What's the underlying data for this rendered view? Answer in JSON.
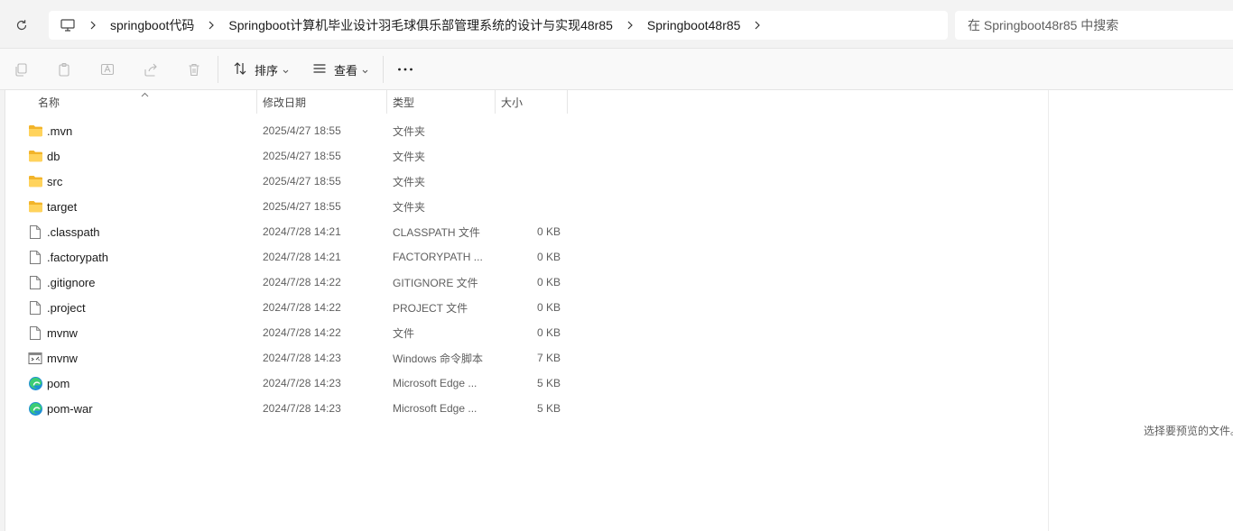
{
  "address_bar": {
    "breadcrumbs": [
      "springboot代码",
      "Springboot计算机毕业设计羽毛球俱乐部管理系统的设计与实现48r85",
      "Springboot48r85"
    ],
    "search_placeholder": "在 Springboot48r85 中搜索"
  },
  "toolbar": {
    "sort_label": "排序",
    "view_label": "查看"
  },
  "columns": {
    "name": "名称",
    "date": "修改日期",
    "type": "类型",
    "size": "大小"
  },
  "files": [
    {
      "name": ".mvn",
      "date": "2025/4/27 18:55",
      "type": "文件夹",
      "size": "",
      "icon": "folder-icon"
    },
    {
      "name": "db",
      "date": "2025/4/27 18:55",
      "type": "文件夹",
      "size": "",
      "icon": "folder-icon"
    },
    {
      "name": "src",
      "date": "2025/4/27 18:55",
      "type": "文件夹",
      "size": "",
      "icon": "folder-icon"
    },
    {
      "name": "target",
      "date": "2025/4/27 18:55",
      "type": "文件夹",
      "size": "",
      "icon": "folder-icon"
    },
    {
      "name": ".classpath",
      "date": "2024/7/28 14:21",
      "type": "CLASSPATH 文件",
      "size": "0 KB",
      "icon": "file-icon"
    },
    {
      "name": ".factorypath",
      "date": "2024/7/28 14:21",
      "type": "FACTORYPATH ...",
      "size": "0 KB",
      "icon": "file-icon"
    },
    {
      "name": ".gitignore",
      "date": "2024/7/28 14:22",
      "type": "GITIGNORE 文件",
      "size": "0 KB",
      "icon": "file-icon"
    },
    {
      "name": ".project",
      "date": "2024/7/28 14:22",
      "type": "PROJECT 文件",
      "size": "0 KB",
      "icon": "file-icon"
    },
    {
      "name": "mvnw",
      "date": "2024/7/28 14:22",
      "type": "文件",
      "size": "0 KB",
      "icon": "file-icon"
    },
    {
      "name": "mvnw",
      "date": "2024/7/28 14:23",
      "type": "Windows 命令脚本",
      "size": "7 KB",
      "icon": "script-icon"
    },
    {
      "name": "pom",
      "date": "2024/7/28 14:23",
      "type": "Microsoft Edge ...",
      "size": "5 KB",
      "icon": "edge-icon"
    },
    {
      "name": "pom-war",
      "date": "2024/7/28 14:23",
      "type": "Microsoft Edge ...",
      "size": "5 KB",
      "icon": "edge-icon"
    }
  ],
  "preview": {
    "empty_text": "选择要预览的文件。"
  }
}
